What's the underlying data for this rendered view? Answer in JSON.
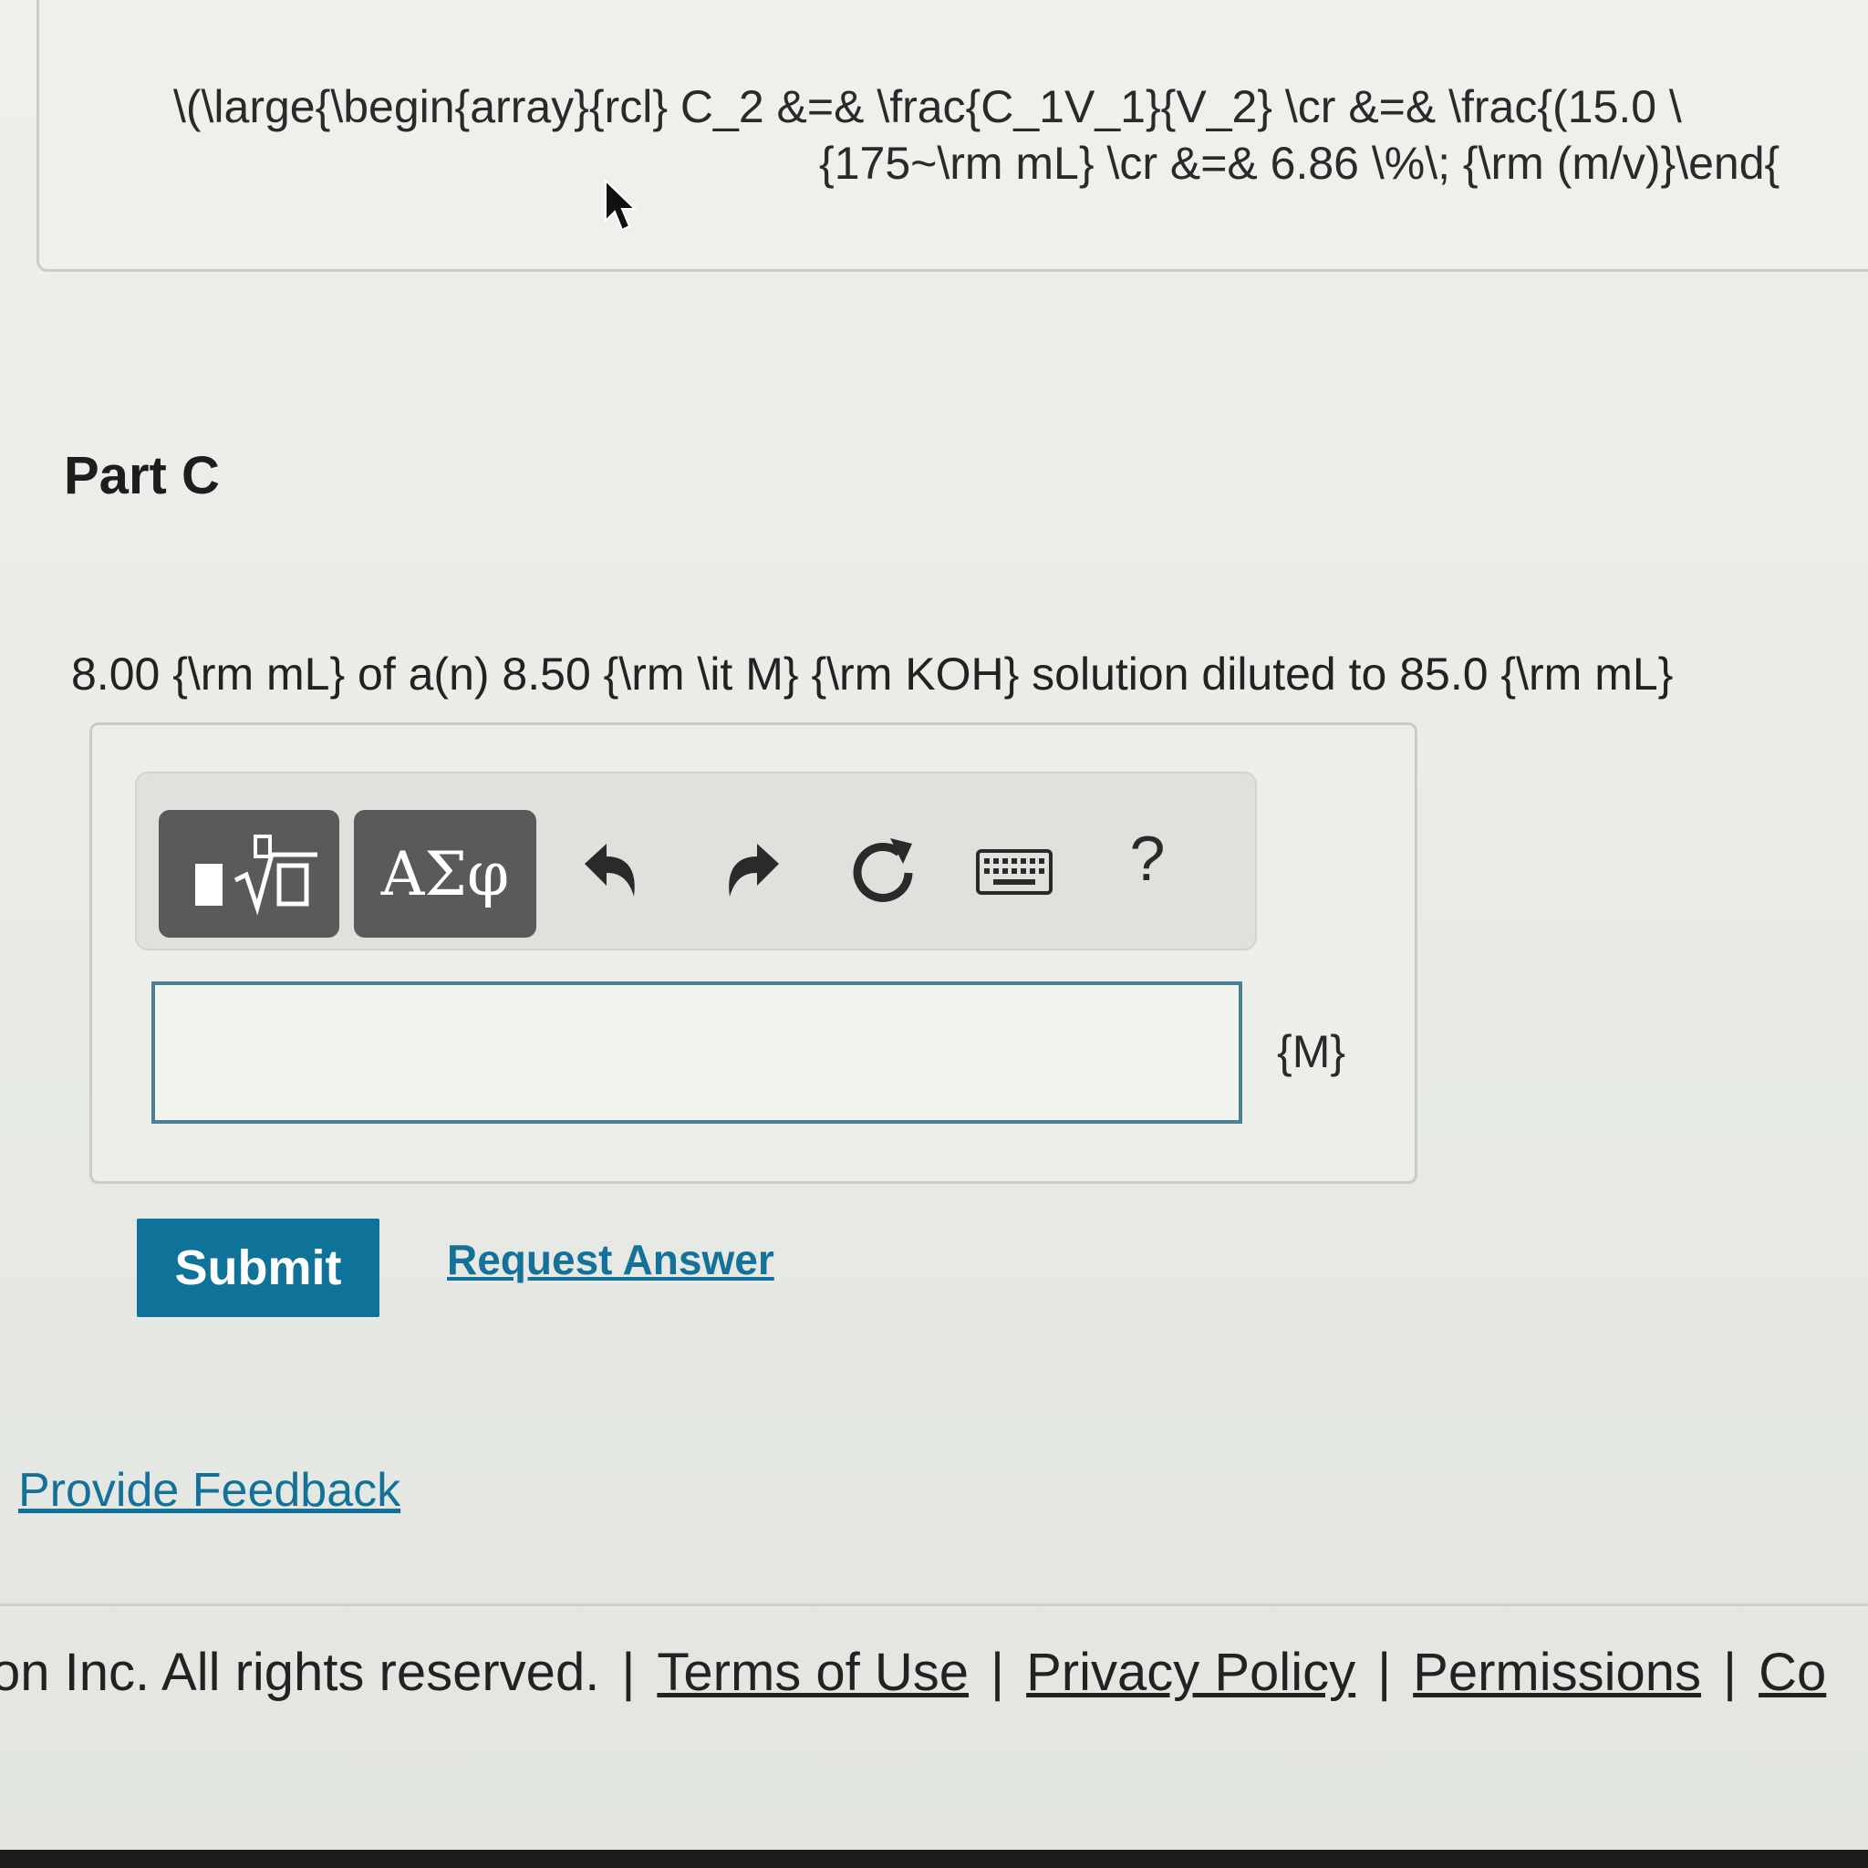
{
  "solution": {
    "line1": "\\(\\large{\\begin{array}{rcl} C_2 &=& \\frac{C_1V_1}{V_2} \\cr &=& \\frac{(15.0 \\",
    "line2": "{175~\\rm mL} \\cr &=& 6.86 \\%\\; {\\rm (m/v)}\\end{"
  },
  "part": {
    "title": "Part C",
    "question": "8.00 {\\rm mL} of a(n) 8.50 {\\rm \\it M} {\\rm KOH} solution diluted to 85.0 {\\rm mL}"
  },
  "toolbar": {
    "templates_icon": "templates-radical-icon",
    "symbols_label": "ΑΣφ",
    "undo_icon": "undo-icon",
    "redo_icon": "redo-icon",
    "reset_icon": "reset-icon",
    "keyboard_icon": "keyboard-icon",
    "help_label": "?"
  },
  "answer": {
    "value": "",
    "unit": "{M}"
  },
  "actions": {
    "submit_label": "Submit",
    "request_label": "Request Answer",
    "feedback_label": "Provide Feedback"
  },
  "footer": {
    "copyright": "on Inc. All rights reserved.",
    "links": [
      "Terms of Use",
      "Privacy Policy",
      "Permissions",
      "Co"
    ]
  },
  "colors": {
    "accent": "#0f7399",
    "link": "#14729a",
    "tool_button": "#5a5a5a",
    "input_border": "#4f7f96"
  }
}
